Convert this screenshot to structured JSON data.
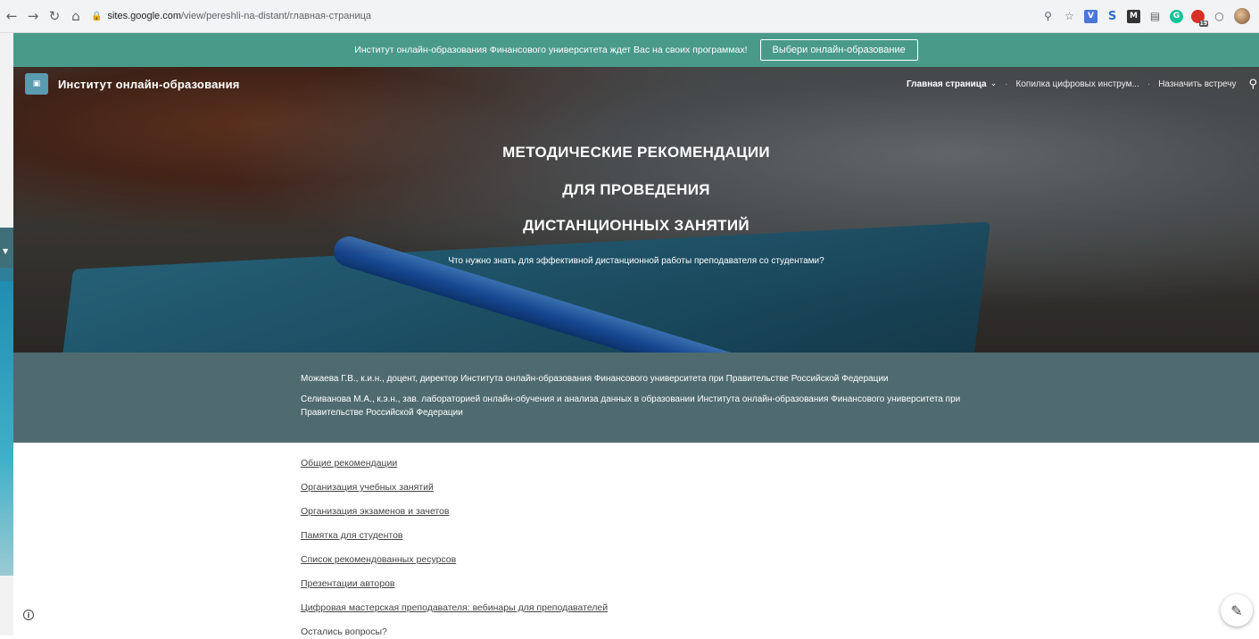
{
  "browser": {
    "url_host": "sites.google.com",
    "url_path": "/view/pereshli-na-distant/главная-страница",
    "nav_icons": [
      "back-icon",
      "forward-icon",
      "reload-icon",
      "home-icon"
    ],
    "extensions": [
      "zoom-icon",
      "star-icon",
      "v-extension-icon",
      "s-extension-icon",
      "m-extension-icon",
      "bookmark-extension-icon",
      "grammarly-icon",
      "badge-extension-icon",
      "circle-extension-icon",
      "profile-avatar"
    ],
    "badge_count": "19"
  },
  "announcement": {
    "text": "Институт онлайн-образования Финансового университета ждет Вас на своих программах!",
    "button_label": "Выбери онлайн-образование"
  },
  "site": {
    "title": "Институт онлайн-образования",
    "nav": {
      "home": "Главная страница",
      "tools": "Копилка цифровых инструм...",
      "meeting": "Назначить встречу"
    }
  },
  "hero": {
    "line1": "МЕТОДИЧЕСКИЕ РЕКОМЕНДАЦИИ",
    "line2": "ДЛЯ ПРОВЕДЕНИЯ",
    "line3": "ДИСТАНЦИОННЫХ ЗАНЯТИЙ",
    "subtitle": "Что нужно знать для эффективной дистанционной работы преподавателя со студентами?"
  },
  "authors": {
    "author1": "Можаева Г.В., к.и.н., доцент, директор Института онлайн-образования Финансового университета при Правительстве Российской Федерации",
    "author2": "Селиванова М.А., к.э.н., зав. лабораторией онлайн-обучения и анализа данных в образовании Института онлайн-образования Финансового университета при Правительстве Российской Федерации"
  },
  "links": [
    "Общие рекомендации",
    "Организация учебных занятий",
    "Организация экзаменов и зачетов",
    "Памятка для студентов",
    "Список рекомендованных ресурсов",
    "Презентации авторов",
    "Цифровая мастерская преподавателя: вебинары для преподавателей"
  ],
  "questions_text": "Остались вопросы?",
  "colors": {
    "announcement_bg": "#4a9a8a",
    "authors_bg": "#4f6b70",
    "link_color": "#444444"
  }
}
